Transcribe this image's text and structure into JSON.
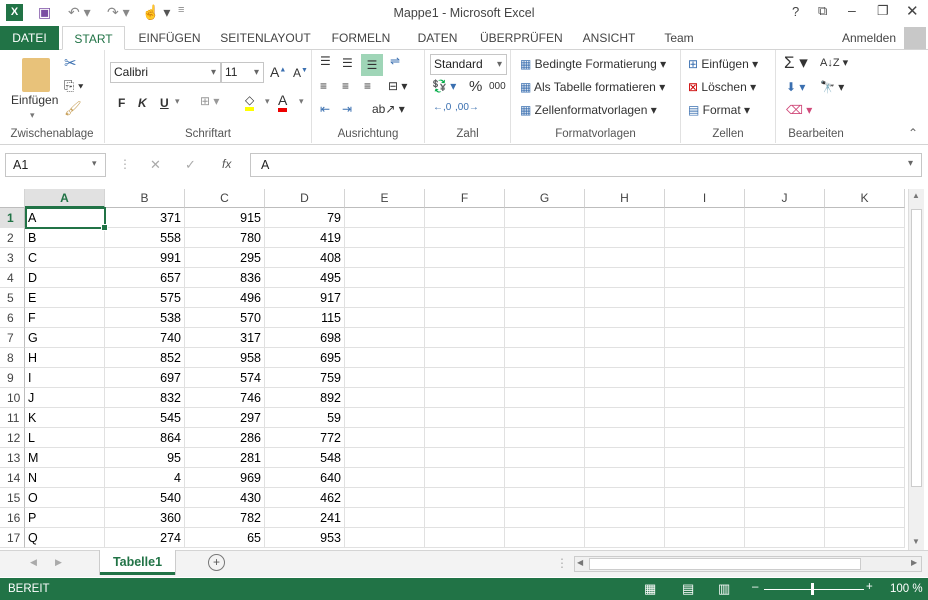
{
  "window": {
    "title": "Mappe1 - Microsoft Excel",
    "help": "?",
    "signin": "Anmelden"
  },
  "tabs": [
    "DATEI",
    "START",
    "EINFÜGEN",
    "SEITENLAYOUT",
    "FORMELN",
    "DATEN",
    "ÜBERPRÜFEN",
    "ANSICHT",
    "Team"
  ],
  "ribbon": {
    "clipboard": {
      "label": "Zwischenablage",
      "paste": "Einfügen"
    },
    "font": {
      "label": "Schriftart",
      "name": "Calibri",
      "size": "11",
      "bold": "F",
      "italic": "K",
      "underline": "U"
    },
    "alignment": {
      "label": "Ausrichtung"
    },
    "number": {
      "label": "Zahl",
      "format": "Standard",
      "percent": "%",
      "thousands": "000"
    },
    "styles": {
      "label": "Formatvorlagen",
      "items": [
        "Bedingte Formatierung",
        "Als Tabelle formatieren",
        "Zellenformatvorlagen"
      ]
    },
    "cells": {
      "label": "Zellen",
      "items": [
        "Einfügen",
        "Löschen",
        "Format"
      ]
    },
    "editing": {
      "label": "Bearbeiten"
    }
  },
  "formula_bar": {
    "name_box": "A1",
    "fx": "fx",
    "value": "A"
  },
  "columns": [
    "A",
    "B",
    "C",
    "D",
    "E",
    "F",
    "G",
    "H",
    "I",
    "J",
    "K"
  ],
  "rows": [
    [
      "A",
      371,
      915,
      79
    ],
    [
      "B",
      558,
      780,
      419
    ],
    [
      "C",
      991,
      295,
      408
    ],
    [
      "D",
      657,
      836,
      495
    ],
    [
      "E",
      575,
      496,
      917
    ],
    [
      "F",
      538,
      570,
      115
    ],
    [
      "G",
      740,
      317,
      698
    ],
    [
      "H",
      852,
      958,
      695
    ],
    [
      "I",
      697,
      574,
      759
    ],
    [
      "J",
      832,
      746,
      892
    ],
    [
      "K",
      545,
      297,
      59
    ],
    [
      "L",
      864,
      286,
      772
    ],
    [
      "M",
      95,
      281,
      548
    ],
    [
      "N",
      4,
      969,
      640
    ],
    [
      "O",
      540,
      430,
      462
    ],
    [
      "P",
      360,
      782,
      241
    ],
    [
      "Q",
      274,
      65,
      953
    ]
  ],
  "sheet_tabs": [
    "Tabelle1"
  ],
  "status": {
    "text": "BEREIT",
    "zoom": "100 %"
  },
  "colors": {
    "accent": "#217346"
  }
}
